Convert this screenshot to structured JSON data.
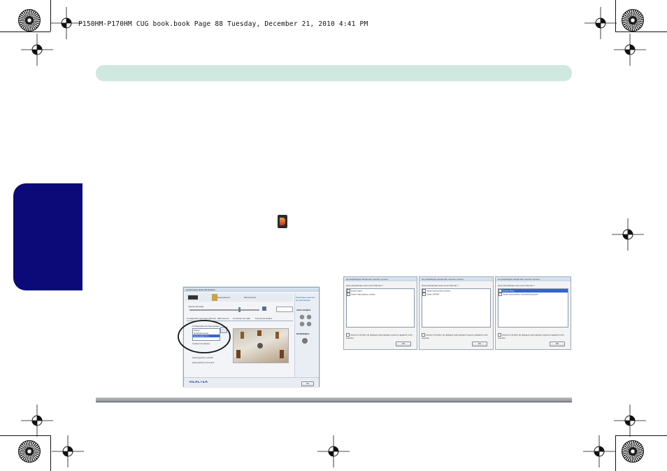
{
  "print_header": "P150HM-P170HM CUG book.book  Page 88  Tuesday, December 21, 2010  4:41 PM",
  "realtek_panel": {
    "window_title": "Gestionnaire audio HD Realtek",
    "tabs": [
      "Haut-parleurs",
      "Microphones"
    ],
    "volume_label": "Volume principal",
    "sub_tabs": [
      "Configuration des haut-parleurs",
      "Effet Sonore",
      "Correction de salle",
      "Format par défaut"
    ],
    "config_label": "Configuration du haut-parleur",
    "config_options": [
      "Stéréo",
      "Quadriphonique",
      "Haut-parleur 5.1"
    ],
    "checkbox_labels": [
      "Caisson de basses",
      "Avant gauche et droite",
      "Haut-parleurs surround"
    ],
    "side_labels": [
      "Paramètres avancés de périphérique",
      "ANALOGIQUE",
      "NUMERIQUE"
    ],
    "brand": "REALTEK",
    "ok_label": "OK",
    "accent_color": "#3366cc"
  },
  "dialogs": [
    {
      "title": "Ce périphérique devrait être reconnu comme :",
      "question": "Quel périphérique avez-vous branché ?",
      "options": [
        "Entrée ligne",
        "Sortie Haut-parleur arrière"
      ],
      "selected": -1,
      "footer": "Activez la fenêtre de dialogue automatique lorsqu'un appareil a été branché",
      "ok_label": "OK"
    },
    {
      "title": "Ce périphérique devrait être reconnu comme :",
      "question": "Quel périphérique avez-vous branché ?",
      "options": [
        "Sortie haut-parleur arrière",
        "Sortie S/PDIF"
      ],
      "selected": -1,
      "footer": "Activez la fenêtre de dialogue automatique lorsqu'un appareil a été branché",
      "ok_label": "OK"
    },
    {
      "title": "Ce périphérique devrait être reconnu comme :",
      "question": "Quel périphérique avez-vous branché ?",
      "options": [
        "Entrée Micro",
        "Sortie haut-parleur Central/Subwoofer"
      ],
      "selected": 0,
      "footer": "Activez la fenêtre de dialogue automatique lorsqu'un appareil a été branché",
      "ok_label": "OK"
    }
  ],
  "colors": {
    "top_band": "#cfe8e0",
    "side_tab": "#0b0a78",
    "bottom_rule": "#9a9ea2"
  }
}
